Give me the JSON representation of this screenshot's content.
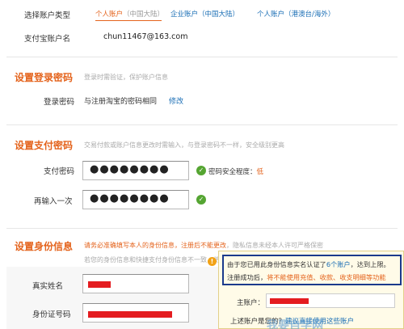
{
  "account_type": {
    "label": "选择账户类型",
    "options": [
      {
        "name": "个人账户",
        "region": "（中国大陆）"
      },
      {
        "name": "企业账户",
        "region": "（中国大陆）"
      },
      {
        "name": "个人账户",
        "region": "（港澳台/海外）"
      }
    ]
  },
  "account_name": {
    "label": "支付宝账户名",
    "value": "chun11467@163.com"
  },
  "login_section": {
    "title": "设置登录密码",
    "desc": "登录时需验证，保护账户信息",
    "field_label": "登录密码",
    "field_text": "与注册淘宝的密码相同",
    "modify_link": "修改"
  },
  "pay_section": {
    "title": "设置支付密码",
    "desc": "交易付款或账户信息更改时需输入，与登录密码不一样，安全级别更高",
    "pay_label": "支付密码",
    "pay_value": "●●●●●●●●",
    "strength_text": "密码安全程度：",
    "strength_value": "低",
    "confirm_label": "再输入一次",
    "confirm_value": "●●●●●●●●"
  },
  "identity_section": {
    "title": "设置身份信息",
    "desc_red": "请务必准确填写本人的身份信息，注册后不能更改",
    "desc_gray": "，隐私信息未经本人许可严格保密",
    "desc_line2": "若您的身份信息和快捷支付身份信息不一致，将会自动关闭已开通的快捷支付服务",
    "real_name_label": "真实姓名",
    "id_label": "身份证号码"
  },
  "tooltip": {
    "line1_pre": "由于您已用此身份信息实名认证了",
    "line1_link": "6个账户",
    "line1_post": "，达到上限。",
    "line2_pre": "注册成功后，",
    "line2_red": "将不能使用充值、收款、收支明细等功能",
    "main_account_label": "主账户：",
    "question": "上述账户是您的？",
    "question_link": "建议直接使用这些账户"
  },
  "watermark": "我要自学网"
}
